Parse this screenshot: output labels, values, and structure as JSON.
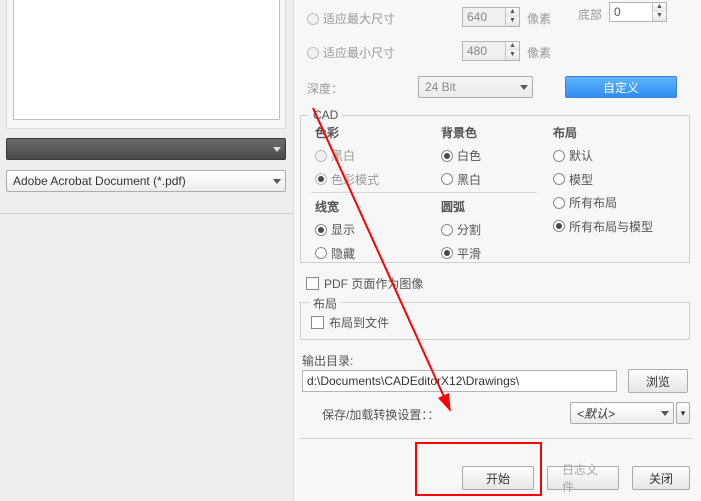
{
  "left": {
    "dropdown_label": "Adobe Acrobat Document (*.pdf)"
  },
  "size": {
    "max_label": "适应最大尺寸",
    "max_value": "640",
    "min_label": "适应最小尺寸",
    "min_value": "480",
    "unit": "像素",
    "depth_label": "深度：",
    "depth_value": "24 Bit",
    "custom_btn": "自定义",
    "bottom_label": "底部",
    "bottom_value": "0"
  },
  "cad": {
    "group_label": "CAD",
    "color": {
      "label": "色彩",
      "bw": "黑白",
      "mode": "色彩模式"
    },
    "bg": {
      "label": "背景色",
      "white": "白色",
      "black": "黑白"
    },
    "layout": {
      "label": "布局",
      "default": "默认",
      "model": "模型",
      "all": "所有布局",
      "allmodel": "所有布局与模型"
    },
    "lw": {
      "label": "线宽",
      "show": "显示",
      "hide": "隐藏"
    },
    "arc": {
      "label": "圆弧",
      "split": "分割",
      "smooth": "平滑"
    }
  },
  "pdf_as_image": "PDF 页面作为图像",
  "layout2": {
    "label": "布局",
    "tofile": "布局到文件"
  },
  "outdir": {
    "label": "输出目录:",
    "value": "d:\\Documents\\CADEditorX12\\Drawings\\",
    "browse": "浏览"
  },
  "save_load": {
    "label": "保存/加载转换设置：：",
    "value": "<默认>"
  },
  "buttons": {
    "start": "开始",
    "log": "日志文件",
    "close": "关闭"
  }
}
